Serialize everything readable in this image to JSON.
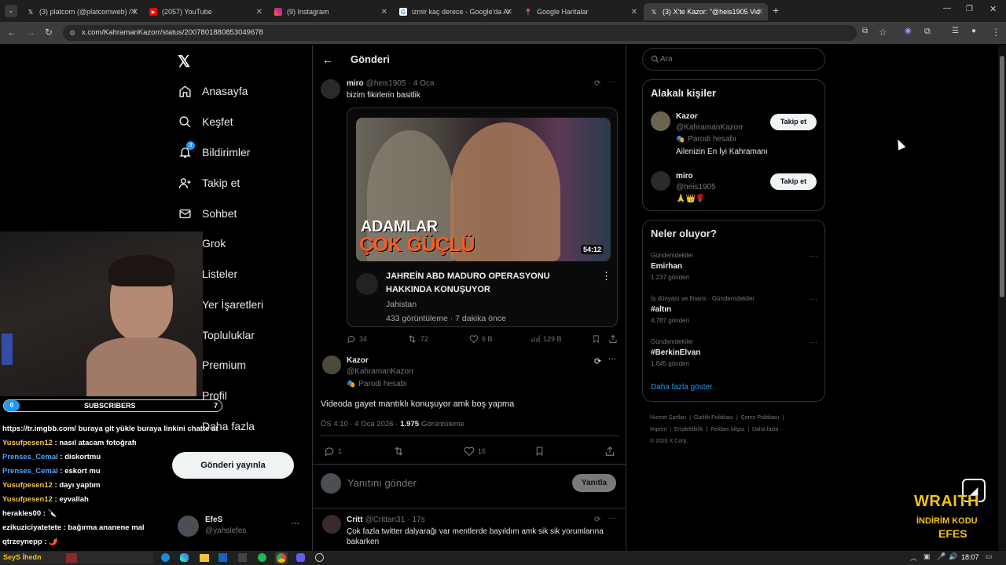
{
  "browser": {
    "tabs": [
      {
        "title": "(3) platcorn (@platcornweb) / X",
        "icon": "x-icon"
      },
      {
        "title": "(2057) YouTube",
        "icon": "youtube-icon"
      },
      {
        "title": "(9) Instagram",
        "icon": "instagram-icon"
      },
      {
        "title": "izmir kaç derece - Google'da Ar",
        "icon": "google-icon"
      },
      {
        "title": "Google Haritalar",
        "icon": "maps-icon"
      },
      {
        "title": "(3) X'te Kazor: \"@heis1905 Vid",
        "icon": "x-icon"
      }
    ],
    "url": "x.com/KahramanKazorr/status/2007801880853049678"
  },
  "sidebar": {
    "items": [
      "Anasayfa",
      "Keşfet",
      "Bildirimler",
      "Takip et",
      "Sohbet",
      "Grok",
      "Listeler",
      "Yer İşaretleri",
      "Topluluklar",
      "Premium",
      "Profil",
      "Daha fazla"
    ],
    "notif_badge": "3",
    "post_button": "Gönderi yayınla",
    "account": {
      "name": "EfeS",
      "handle": "@yahslefes"
    }
  },
  "main": {
    "header": "Gönderi",
    "quoted": {
      "name": "miro",
      "handle": "@heis1905",
      "date": "4 Oca",
      "text": "bizim fikirlerin basitlik",
      "video": {
        "thumb_line1": "ADAMLAR",
        "thumb_line2": "ÇOK GÜÇLÜ",
        "duration": "54:12",
        "title": "JAHREİN ABD MADURO OPERASYONU HAKKINDA KONUŞUYOR",
        "channel": "Jahistan",
        "meta": "433 görüntüleme · 7 dakika önce"
      },
      "stats": {
        "replies": "34",
        "reposts": "72",
        "likes": "6 B",
        "views": "129 B"
      }
    },
    "post": {
      "name": "Kazor",
      "handle": "@KahramanKazorr",
      "label": "Parodi hesabı",
      "text": "Videoda gayet mantıklı konuşuyor amk boş yapma",
      "time": "ÖS 4:10 · 4 Oca 2026 ·",
      "views_count": "1.975",
      "views_label": "Görüntüleme",
      "stats": {
        "replies": "1",
        "likes": "16"
      }
    },
    "reply_box": {
      "placeholder": "Yanıtını gönder",
      "button": "Yanıtla"
    },
    "reply": {
      "name": "Critt",
      "handle": "@Crittari31",
      "date": "17s",
      "text": "Çok fazla twitter dalyarağı var mentlerde bayıldım amk sik sik yorumlarına bakarken"
    }
  },
  "right": {
    "search_placeholder": "Ara",
    "related_title": "Alakalı kişiler",
    "people": [
      {
        "name": "Kazor",
        "handle": "@KahramanKazorr",
        "label": "Parodi hesabı",
        "bio": "Ailenizin En İyi Kahramanı",
        "button": "Takip et"
      },
      {
        "name": "miro",
        "handle": "@heis1905",
        "bio": "🙏👑🌹",
        "button": "Takip et"
      }
    ],
    "trends_title": "Neler oluyor?",
    "trends": [
      {
        "context": "Gündemdekiler",
        "name": "Emirhan",
        "count": "1.237 gönderi"
      },
      {
        "context": "İş dünyası ve finans · Gündemdekiler",
        "name": "#altın",
        "count": "4.787 gönderi"
      },
      {
        "context": "Gündemdekiler",
        "name": "#BerkinElvan",
        "count": "1.645 gönderi"
      }
    ],
    "show_more": "Daha fazla göster",
    "footer": [
      "Hizmet Şartları",
      "Gizlilik Politikası",
      "Çerez Politikası",
      "Imprint",
      "Erişilebilirlik",
      "Reklam bilgisi",
      "Daha fazla ···",
      "© 2026 X Corp."
    ]
  },
  "overlay": {
    "subscribers_label": "SUBSCRIBERS",
    "subscribers_left": "0",
    "subscribers_right": "7",
    "chat": [
      {
        "user": "",
        "text": "https://tr.imgbb.com/ buraya git yükle buraya linkini chatte at"
      },
      {
        "user": "Yusufpesen12",
        "text": " : nasıl atacam fotoğrafı"
      },
      {
        "user": "Prenses_Cemal",
        "text": " : diskortmu"
      },
      {
        "user": "Prenses_Cemal",
        "text": " : eskort mu"
      },
      {
        "user": "Yusufpesen12",
        "text": " : dayı yaptım"
      },
      {
        "user": "Yusufpesen12",
        "text": " : eyvallah"
      },
      {
        "user": "herakles00",
        "text": " : 🔪"
      },
      {
        "user": "ezikuziciyatetete",
        "text": " : bağırma ananene mal"
      },
      {
        "user": "qtrzeynepp",
        "text": " : 🌶️"
      }
    ],
    "sponsor_line1": "WRAITH",
    "sponsor_line2": "İNDİRİM KODU",
    "sponsor_line3": "EFES"
  },
  "taskbar": {
    "time": "18:07",
    "stream_label": "SeyS İhedn"
  },
  "colors": {
    "accent": "#1d9bf0",
    "chat_user_yellow": "#f5c542",
    "chat_user_blue": "#4fa3ff",
    "sponsor_yellow": "#f2c318"
  }
}
